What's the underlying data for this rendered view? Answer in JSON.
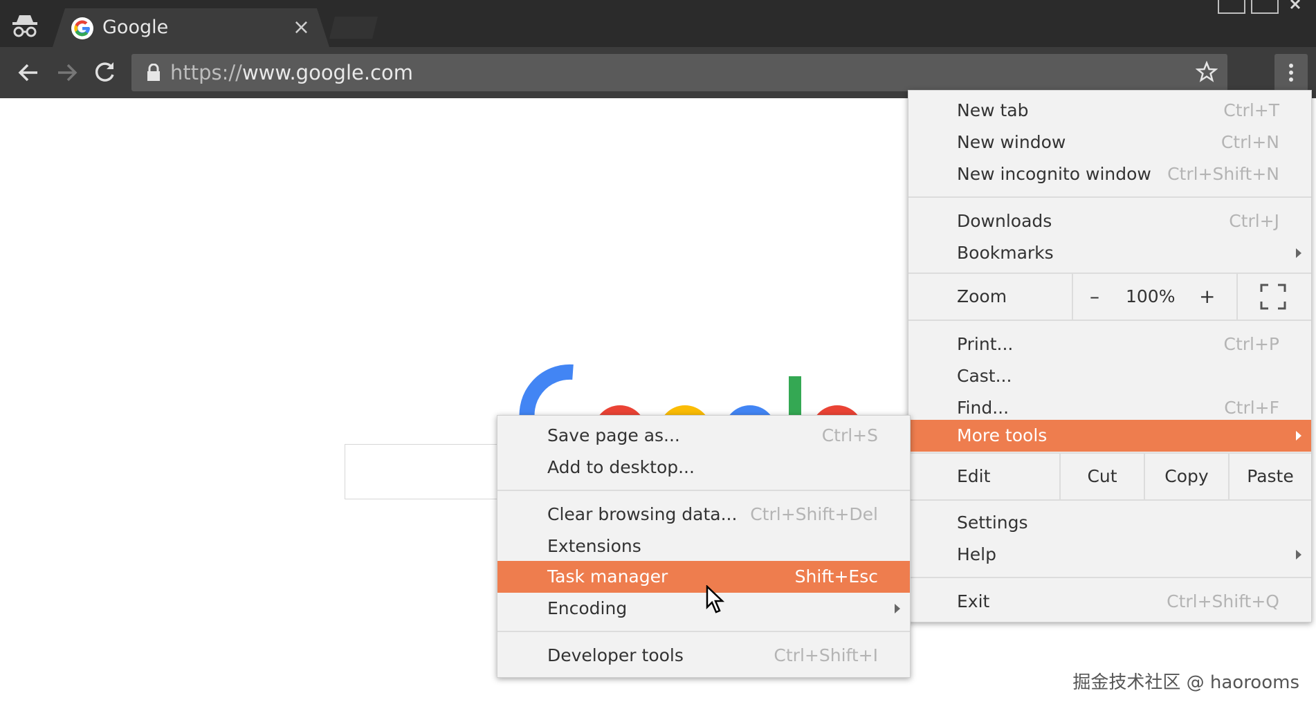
{
  "browser": {
    "tab_title": "Google",
    "tab_close": "×",
    "url_scheme": "https://",
    "url_rest": "www.google.com"
  },
  "page": {
    "watermark": "掘金技术社区 @ haorooms"
  },
  "main_menu": {
    "new_tab": {
      "label": "New tab",
      "shortcut": "Ctrl+T"
    },
    "new_window": {
      "label": "New window",
      "shortcut": "Ctrl+N"
    },
    "new_incognito": {
      "label": "New incognito window",
      "shortcut": "Ctrl+Shift+N"
    },
    "downloads": {
      "label": "Downloads",
      "shortcut": "Ctrl+J"
    },
    "bookmarks": {
      "label": "Bookmarks"
    },
    "zoom": {
      "label": "Zoom",
      "minus": "–",
      "value": "100%",
      "plus": "+"
    },
    "print": {
      "label": "Print...",
      "shortcut": "Ctrl+P"
    },
    "cast": {
      "label": "Cast..."
    },
    "find": {
      "label": "Find...",
      "shortcut": "Ctrl+F"
    },
    "more_tools": {
      "label": "More tools"
    },
    "edit": {
      "label": "Edit",
      "cut": "Cut",
      "copy": "Copy",
      "paste": "Paste"
    },
    "settings": {
      "label": "Settings"
    },
    "help": {
      "label": "Help"
    },
    "exit": {
      "label": "Exit",
      "shortcut": "Ctrl+Shift+Q"
    }
  },
  "sub_menu": {
    "save_page": {
      "label": "Save page as...",
      "shortcut": "Ctrl+S"
    },
    "add_desktop": {
      "label": "Add to desktop..."
    },
    "clear_data": {
      "label": "Clear browsing data...",
      "shortcut": "Ctrl+Shift+Del"
    },
    "extensions": {
      "label": "Extensions"
    },
    "task_manager": {
      "label": "Task manager",
      "shortcut": "Shift+Esc"
    },
    "encoding": {
      "label": "Encoding"
    },
    "dev_tools": {
      "label": "Developer tools",
      "shortcut": "Ctrl+Shift+I"
    }
  },
  "colors": {
    "highlight": "#ee7d4e",
    "toolbar": "#3c3c3c",
    "titlebar": "#2b2b2b"
  },
  "icons": [
    "incognito-icon",
    "google-favicon-icon",
    "close-icon",
    "back-arrow-icon",
    "forward-arrow-icon",
    "reload-icon",
    "lock-icon",
    "star-icon",
    "three-dot-menu-icon",
    "fullscreen-icon",
    "submenu-arrow-icon",
    "mouse-cursor-icon"
  ]
}
